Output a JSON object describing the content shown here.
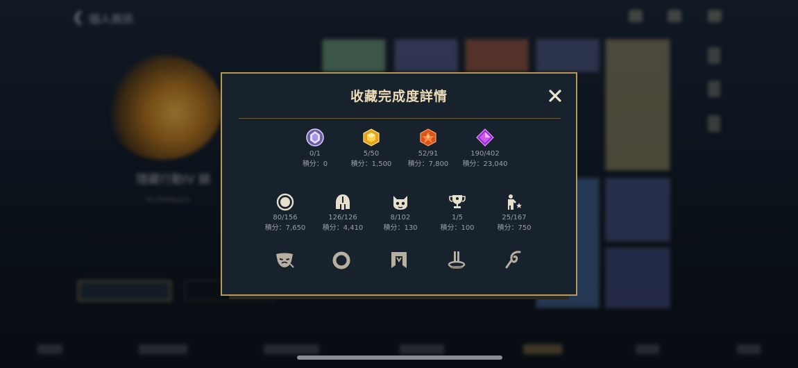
{
  "background": {
    "header_title": "個人資訊",
    "profile_name": "隱藏行動IV 韻",
    "profile_sub": "Ss.Adoby.pxr",
    "left_button_label": "前往",
    "bottom_tabs": [
      "總覽",
      "英雄與造型",
      "收藏的造型",
      "造型收藏",
      "收藏完成度",
      "表情",
      "圖示"
    ]
  },
  "modal": {
    "title": "收藏完成度詳情",
    "close_icon": "close-icon",
    "accent_color": "#b99a57",
    "gem_stats": [
      {
        "icon": "rarity-diamond-purple-white-icon",
        "count": "0/1",
        "score": "積分：0"
      },
      {
        "icon": "rarity-gem-gold-icon",
        "count": "5/50",
        "score": "積分：1,500"
      },
      {
        "icon": "rarity-gem-orange-icon",
        "count": "52/91",
        "score": "積分：7,800"
      },
      {
        "icon": "rarity-gem-purple-icon",
        "count": "190/402",
        "score": "積分：23,040"
      }
    ],
    "category_stats": [
      {
        "icon": "champion-circle-icon",
        "count": "80/156",
        "score": "積分：7,650"
      },
      {
        "icon": "helmet-icon",
        "count": "126/126",
        "score": "積分：4,410"
      },
      {
        "icon": "poro-face-icon",
        "count": "8/102",
        "score": "積分：130"
      },
      {
        "icon": "trophy-icon",
        "count": "1/5",
        "score": "積分：100"
      },
      {
        "icon": "pose-emote-icon",
        "count": "25/167",
        "score": "積分：750"
      }
    ],
    "locked_categories": [
      "mask-icon",
      "ring-icon",
      "banner-frame-icon",
      "platform-icon",
      "ward-icon"
    ]
  }
}
